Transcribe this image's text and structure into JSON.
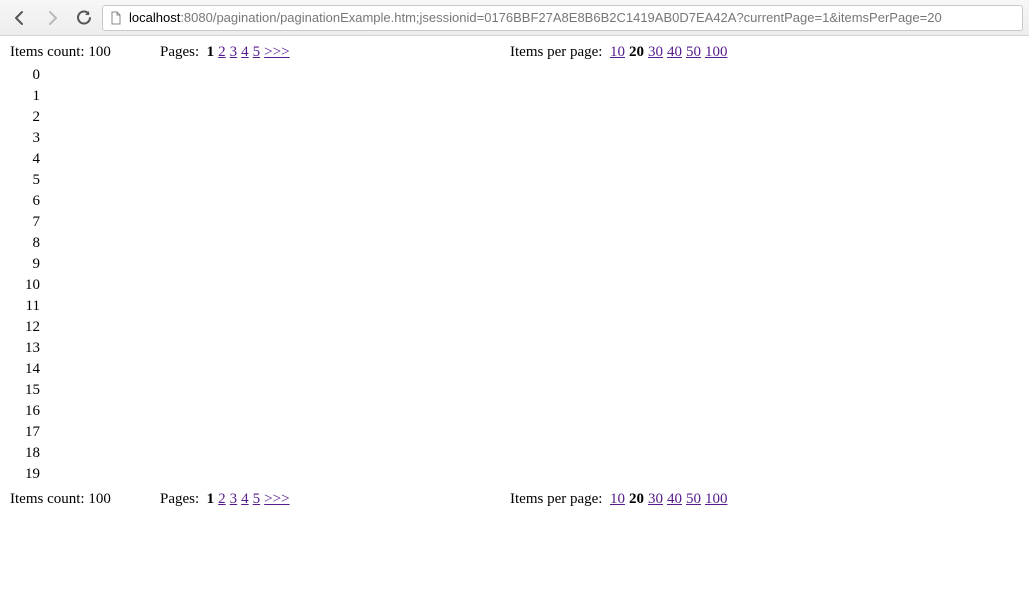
{
  "browser": {
    "url_host": "localhost",
    "url_rest": ":8080/pagination/paginationExample.htm;jsessionid=0176BBF27A8E8B6B2C1419AB0D7EA42A?currentPage=1&itemsPerPage=20"
  },
  "pagination": {
    "items_count_label": "Items count:",
    "items_count_value": "100",
    "pages_label": "Pages:",
    "current_page": "1",
    "page_links": [
      "2",
      "3",
      "4",
      "5"
    ],
    "next_set": ">>>",
    "ipp_label": "Items per page:",
    "ipp_current": "20",
    "ipp_options_before": [
      "10"
    ],
    "ipp_options_after": [
      "30",
      "40",
      "50",
      "100"
    ]
  },
  "items": [
    "0",
    "1",
    "2",
    "3",
    "4",
    "5",
    "6",
    "7",
    "8",
    "9",
    "10",
    "11",
    "12",
    "13",
    "14",
    "15",
    "16",
    "17",
    "18",
    "19"
  ]
}
